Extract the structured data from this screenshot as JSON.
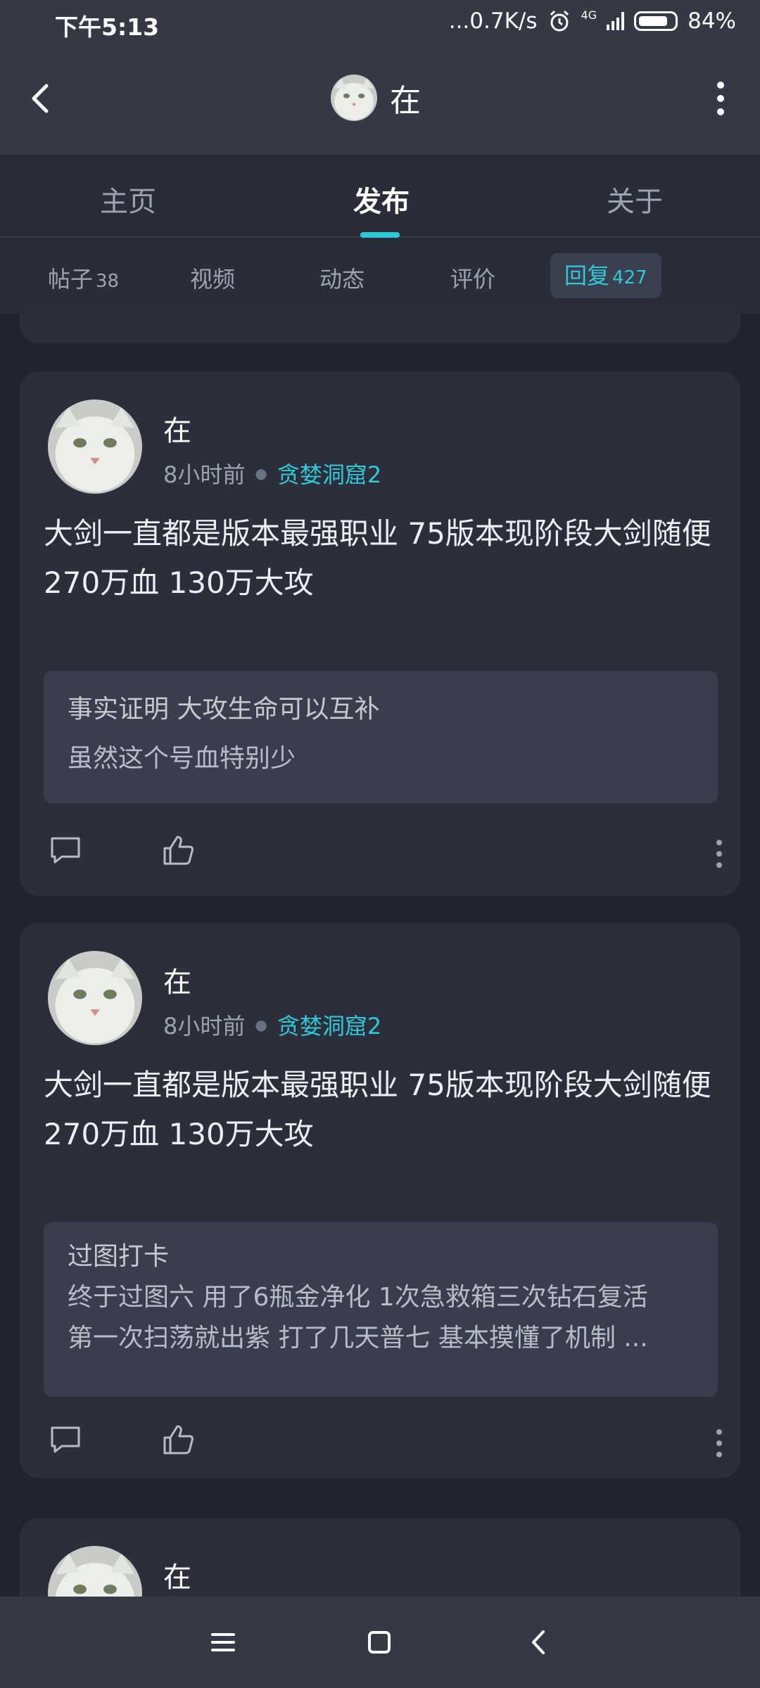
{
  "status_bar": {
    "time": "下午5:13",
    "network_speed": "...0.7K/s",
    "network_type": "4G",
    "battery": "84%"
  },
  "app_bar": {
    "title": "在"
  },
  "tabs": [
    {
      "label": "主页"
    },
    {
      "label": "发布"
    },
    {
      "label": "关于"
    }
  ],
  "subtabs": [
    {
      "label": "帖子",
      "count": "38"
    },
    {
      "label": "视频",
      "count": ""
    },
    {
      "label": "动态",
      "count": ""
    },
    {
      "label": "评价",
      "count": ""
    },
    {
      "label": "回复",
      "count": "427"
    }
  ],
  "posts": [
    {
      "author": "在",
      "time": "8小时前",
      "game": "贪婪洞窟2",
      "content": "大剑一直都是版本最强职业 75版本现阶段大剑随便270万血 130万大攻",
      "quote_line1": "事实证明 大攻生命可以互补",
      "quote_line2": "虽然这个号血特别少",
      "quote_line3": ""
    },
    {
      "author": "在",
      "time": "8小时前",
      "game": "贪婪洞窟2",
      "content": "大剑一直都是版本最强职业 75版本现阶段大剑随便270万血 130万大攻",
      "quote_line1": "过图打卡",
      "quote_line2": "终于过图六 用了6瓶金净化 1次急救箱三次钻石复活",
      "quote_line3": "第一次扫荡就出紫 打了几天普七 基本摸懂了机制 ..."
    },
    {
      "author": "在"
    }
  ],
  "icons": {
    "back": "back-arrow-icon",
    "more": "more-vertical-icon",
    "comment": "comment-icon",
    "like": "thumbs-up-icon",
    "nav_menu": "menu-icon",
    "nav_home": "home-square-icon",
    "nav_back": "back-chevron-icon"
  },
  "colors": {
    "accent": "#2fc8d6",
    "background": "#21232f",
    "card": "#2c2f3b",
    "header": "#353946"
  }
}
